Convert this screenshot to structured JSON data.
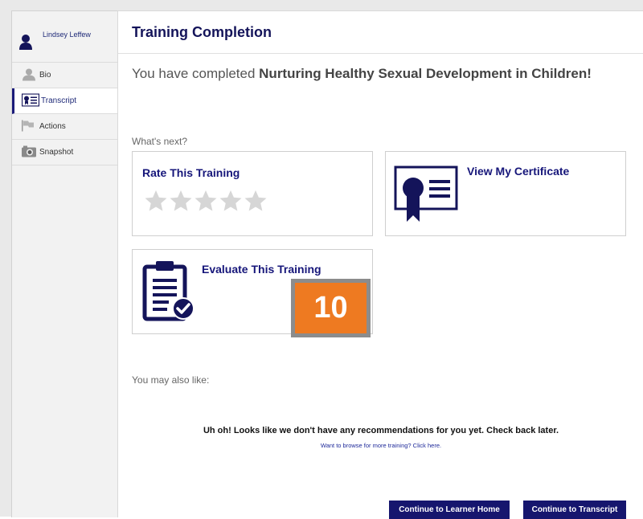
{
  "sidebar": {
    "user_name": "Lindsey Leffew",
    "items": [
      {
        "label": "Bio",
        "icon": "person-icon"
      },
      {
        "label": "Transcript",
        "icon": "transcript-icon",
        "active": true
      },
      {
        "label": "Actions",
        "icon": "flag-icon"
      },
      {
        "label": "Snapshot",
        "icon": "camera-icon"
      }
    ]
  },
  "main": {
    "title": "Training Completion",
    "completed_prefix": "You have completed ",
    "course_name": "Nurturing Healthy Sexual Development in Children!",
    "whats_next": "What's next?",
    "rate_title": "Rate This Training",
    "rating_stars": 5,
    "certificate_title": "View My Certificate",
    "evaluate_title": "Evaluate This Training",
    "badge_number": "10",
    "also_like": "You may also like:",
    "no_recs": "Uh oh! Looks like we don't have any recommendations for you yet. Check back later.",
    "browse_link": "Want to browse for more training? Click here.",
    "btn_learner_home": "Continue to Learner Home",
    "btn_transcript": "Continue to Transcript"
  },
  "colors": {
    "navy": "#16166e",
    "badge_orange": "#ee7a21",
    "star_gray": "#d6d6d6"
  }
}
